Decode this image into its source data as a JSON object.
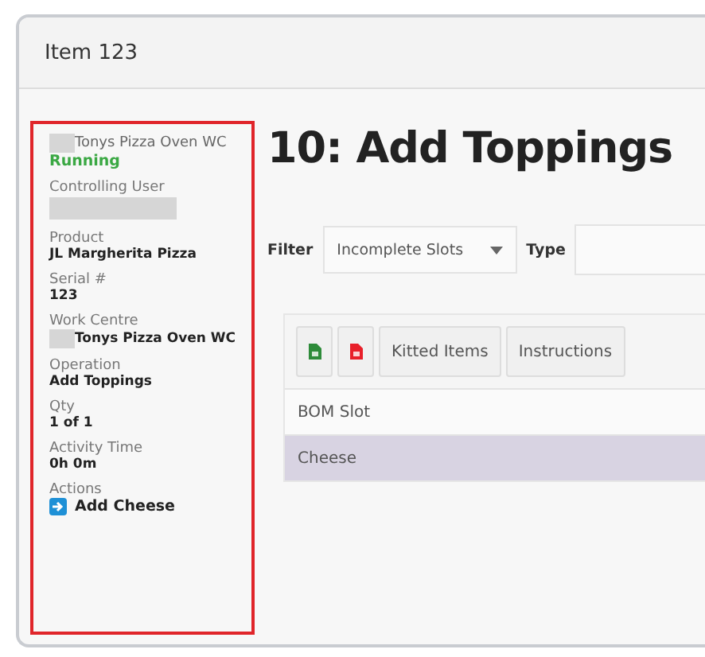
{
  "window": {
    "title": "Item 123"
  },
  "sidebar": {
    "work_centre_header": "Tonys Pizza Oven WC",
    "status": "Running",
    "fields": [
      {
        "label": "Controlling User",
        "redacted": true
      },
      {
        "label": "Product",
        "value": "JL Margherita Pizza"
      },
      {
        "label": "Serial #",
        "value": "123"
      },
      {
        "label": "Work Centre",
        "value": "Tonys Pizza Oven WC",
        "icon": true
      },
      {
        "label": "Operation",
        "value": "Add Toppings"
      },
      {
        "label": "Qty",
        "value": "1 of 1"
      },
      {
        "label": "Activity Time",
        "value": "0h 0m"
      }
    ],
    "actions_label": "Actions",
    "actions": [
      {
        "label": "Add Cheese"
      }
    ]
  },
  "heading": "10: Add Toppings",
  "filter": {
    "label": "Filter",
    "value": "Incomplete Slots",
    "type_label": "Type"
  },
  "toolbar": [
    {
      "kind": "excel"
    },
    {
      "kind": "pdf"
    },
    {
      "kind": "text",
      "label": "Kitted Items"
    },
    {
      "kind": "text",
      "label": "Instructions"
    }
  ],
  "table": {
    "columns": [
      "BOM Slot"
    ],
    "rows": [
      {
        "cells": [
          "Cheese"
        ],
        "selected": true
      }
    ]
  }
}
